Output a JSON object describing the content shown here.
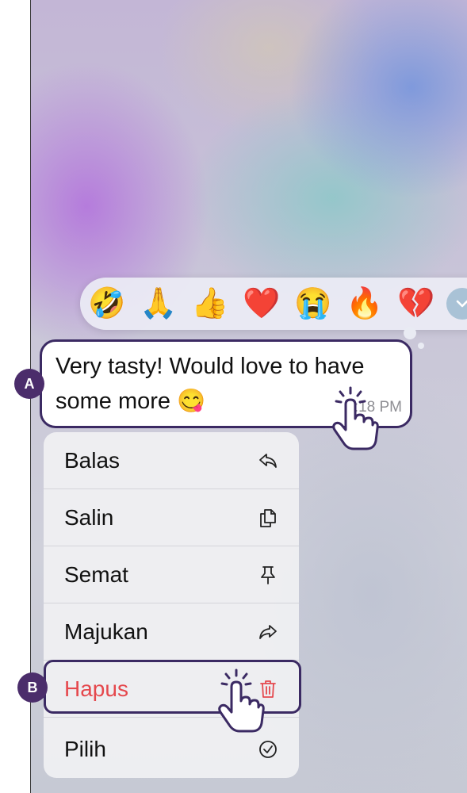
{
  "message": {
    "line1": "Very tasty! Would love to have",
    "line2": "some more 😋",
    "time": "4:18 PM"
  },
  "reactions": [
    "🤣",
    "🙏",
    "👍",
    "❤️",
    "😭",
    "🔥",
    "💔"
  ],
  "reactions_more_icon": "chevron-down-icon",
  "menu": {
    "items": [
      {
        "label": "Balas",
        "icon": "reply-icon"
      },
      {
        "label": "Salin",
        "icon": "copy-icon"
      },
      {
        "label": "Semat",
        "icon": "pin-icon"
      },
      {
        "label": "Majukan",
        "icon": "forward-icon"
      },
      {
        "label": "Hapus",
        "icon": "trash-icon"
      },
      {
        "label": "Pilih",
        "icon": "check-circle-icon"
      }
    ]
  },
  "annotations": {
    "a": "A",
    "b": "B"
  },
  "colors": {
    "accent_outline": "#3b2a63",
    "label_badge": "#4b2d6b",
    "danger": "#e5484d"
  }
}
